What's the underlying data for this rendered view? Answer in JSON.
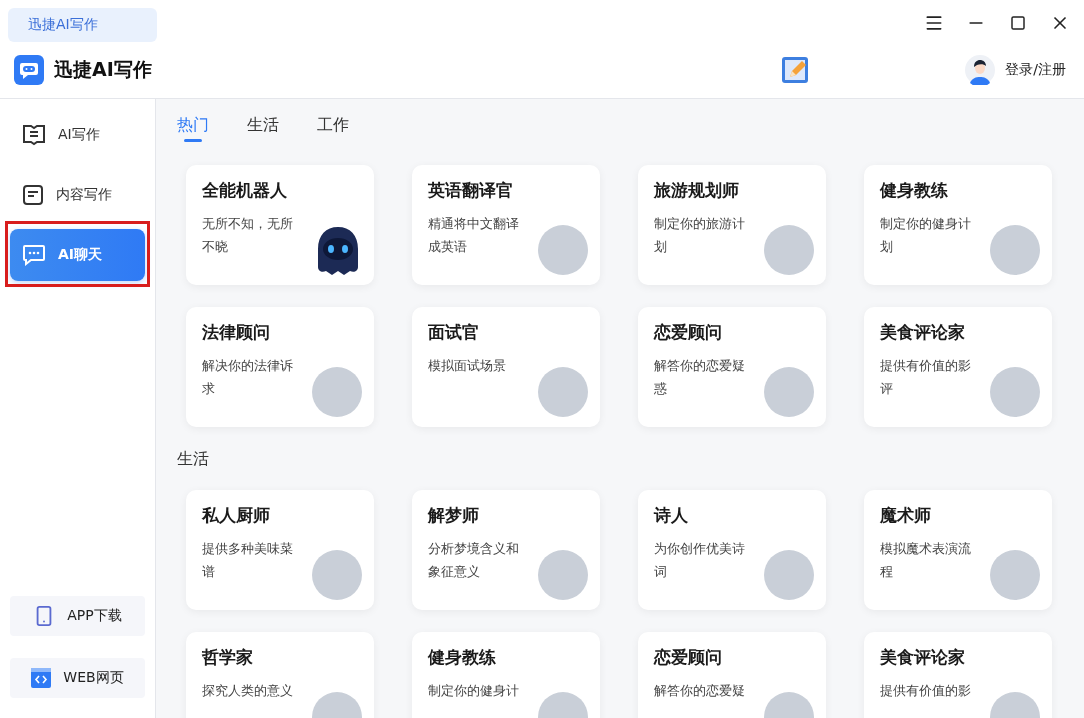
{
  "titlebar": {
    "tab": "迅捷AI写作"
  },
  "header": {
    "app_name": "迅捷AI写作",
    "login": "登录/注册"
  },
  "sidebar": {
    "items": [
      {
        "label": "AI写作",
        "kind": "book",
        "selected": false,
        "annotated": false
      },
      {
        "label": "内容写作",
        "kind": "doc",
        "selected": false,
        "annotated": false
      },
      {
        "label": "AI聊天",
        "kind": "chat",
        "selected": true,
        "annotated": true
      }
    ],
    "bottom_buttons": [
      {
        "label": "APP下载",
        "kind": "phone"
      },
      {
        "label": "WEB网页",
        "kind": "web"
      }
    ]
  },
  "tabs": [
    {
      "label": "热门",
      "selected": true
    },
    {
      "label": "生活",
      "selected": false
    },
    {
      "label": "工作",
      "selected": false
    }
  ],
  "sections": [
    {
      "cards": [
        {
          "title": "全能机器人",
          "description": "无所不知，无所不晓",
          "kind": "robot"
        },
        {
          "title": "英语翻译官",
          "description": "精通将中文翻译成英语",
          "kind": "person"
        },
        {
          "title": "旅游规划师",
          "description": "制定你的旅游计划",
          "kind": "person"
        },
        {
          "title": "健身教练",
          "description": "制定你的健身计划",
          "kind": "person"
        },
        {
          "title": "法律顾问",
          "description": "解决你的法律诉求",
          "kind": "person"
        },
        {
          "title": "面试官",
          "description": "模拟面试场景",
          "kind": "person"
        },
        {
          "title": "恋爱顾问",
          "description": "解答你的恋爱疑惑",
          "kind": "person"
        },
        {
          "title": "美食评论家",
          "description": "提供有价值的影评",
          "kind": "person"
        }
      ]
    },
    {
      "heading": "生活",
      "cards": [
        {
          "title": "私人厨师",
          "description": "提供多种美味菜谱",
          "kind": "person"
        },
        {
          "title": "解梦师",
          "description": "分析梦境含义和象征意义",
          "kind": "person"
        },
        {
          "title": "诗人",
          "description": "为你创作优美诗词",
          "kind": "person"
        },
        {
          "title": "魔术师",
          "description": "模拟魔术表演流程",
          "kind": "person"
        },
        {
          "title": "哲学家",
          "description": "探究人类的意义",
          "kind": "person"
        },
        {
          "title": "健身教练",
          "description": "制定你的健身计",
          "kind": "person"
        },
        {
          "title": "恋爱顾问",
          "description": "解答你的恋爱疑",
          "kind": "person"
        },
        {
          "title": "美食评论家",
          "description": "提供有价值的影",
          "kind": "person"
        }
      ]
    }
  ]
}
